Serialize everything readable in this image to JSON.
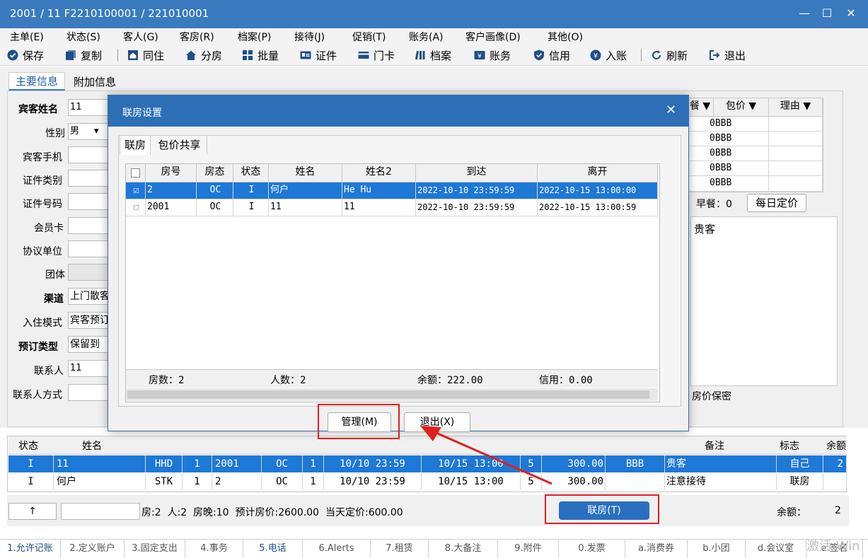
{
  "window": {
    "title": "2001 / 11 F2210100001 / 221010001",
    "controls": [
      "—",
      "☐",
      "✕"
    ]
  },
  "menu": [
    "主单(E)",
    "状态(S)",
    "客人(G)",
    "客房(R)",
    "档案(P)",
    "接待(J)",
    "促销(T)",
    "账务(A)",
    "客户画像(D)",
    "其他(O)"
  ],
  "toolbar": [
    "保存",
    "复制",
    "同住",
    "分房",
    "批量",
    "证件",
    "门卡",
    "档案",
    "账务",
    "信用",
    "入账",
    "刷新",
    "退出"
  ],
  "main_tabs": [
    "主要信息",
    "附加信息"
  ],
  "form": {
    "guest_name_label": "宾客姓名",
    "guest_name_value": "11",
    "gender_label": "性别",
    "gender_value": "男",
    "phone_label": "宾客手机",
    "id_type_label": "证件类别",
    "id_number_label": "证件号码",
    "member_card_label": "会员卡",
    "agreement_label": "协议单位",
    "group_label": "团体",
    "channel_label": "渠道",
    "channel_value": "上门散客",
    "checkin_mode_label": "入住模式",
    "checkin_mode_value": "宾客预订",
    "booking_type_label": "预订类型",
    "booking_type_value": "保留到",
    "contact_label": "联系人",
    "contact_value": "11",
    "contact_method_label": "联系人方式"
  },
  "price_grid": {
    "headers": [
      "餐 ▼",
      "包价 ▼",
      "理由 ▼"
    ],
    "rows": [
      "0BBB",
      "0BBB",
      "0BBB",
      "0BBB",
      "0BBB"
    ]
  },
  "right_panel": {
    "breakfast_label": "早餐：0",
    "daily_price_button": "每日定价",
    "remark": "贵客",
    "price_secret": "房价保密"
  },
  "dialog": {
    "title": "联房设置",
    "tabs": [
      "联房",
      "包价共享"
    ],
    "columns": [
      "房号",
      "房态",
      "状态",
      "姓名",
      "姓名2",
      "到达",
      "离开"
    ],
    "rows": [
      {
        "checked": "☑",
        "room": "2",
        "room_status": "OC",
        "status": "I",
        "name": "何户",
        "name2": "He Hu",
        "arrive": "2022-10-10 23:59:59",
        "depart": "2022-10-15 13:00:00"
      },
      {
        "checked": "☐",
        "room": "2001",
        "room_status": "OC",
        "status": "I",
        "name": "11",
        "name2": "11",
        "arrive": "2022-10-10 23:59:59",
        "depart": "2022-10-15 13:00:59"
      }
    ],
    "footer": {
      "rooms": "房数：2",
      "people": "人数：2",
      "balance": "余额：222.00",
      "credit": "信用：0.00"
    },
    "manage_button": "管理(M)",
    "exit_button": "退出(X)"
  },
  "bottom_grid": {
    "headers": [
      "状态",
      "姓名",
      "备注",
      "标志",
      "余额"
    ],
    "rows": [
      {
        "status": "I",
        "name": "11",
        "type": "HHD",
        "num": "1",
        "room": "2001",
        "rstatus": "OC",
        "people": "1",
        "arrive": "10/10 23:59",
        "depart": "10/15 13:00",
        "nights": "5",
        "price": "300.00",
        "pkg": "BBB",
        "remark": "贵客",
        "flag": "自己",
        "bal": "2"
      },
      {
        "status": "I",
        "name": "何户",
        "type": "STK",
        "num": "1",
        "room": "2",
        "rstatus": "OC",
        "people": "1",
        "arrive": "10/10 23:59",
        "depart": "10/15 13:00",
        "nights": "5",
        "price": "300.00",
        "pkg": "",
        "remark": "注意接待",
        "flag": "联房",
        "bal": ""
      }
    ]
  },
  "summary": {
    "up_arrow": "↑",
    "text": "房:2  人:2  房晚:10  预计房价:2600.00  当天定价:600.00",
    "linked_room_button": "联房(T)",
    "balance_label": "余额：",
    "balance_value": "2"
  },
  "bottom_tabs": [
    "1.允许记账",
    "2.定义账户",
    "3.固定支出",
    "4.事务",
    "5.电话",
    "6.Alerts",
    "7.租赁",
    "8.大备注",
    "9.附件",
    "0.发票",
    "a.消费券",
    "b.小团",
    "d.会议室",
    "e.签名"
  ],
  "watermark": "激活 Win",
  "colors": {
    "accent": "#2d6fb6",
    "selection": "#1e78d7",
    "highlight": "#e01f1f"
  }
}
